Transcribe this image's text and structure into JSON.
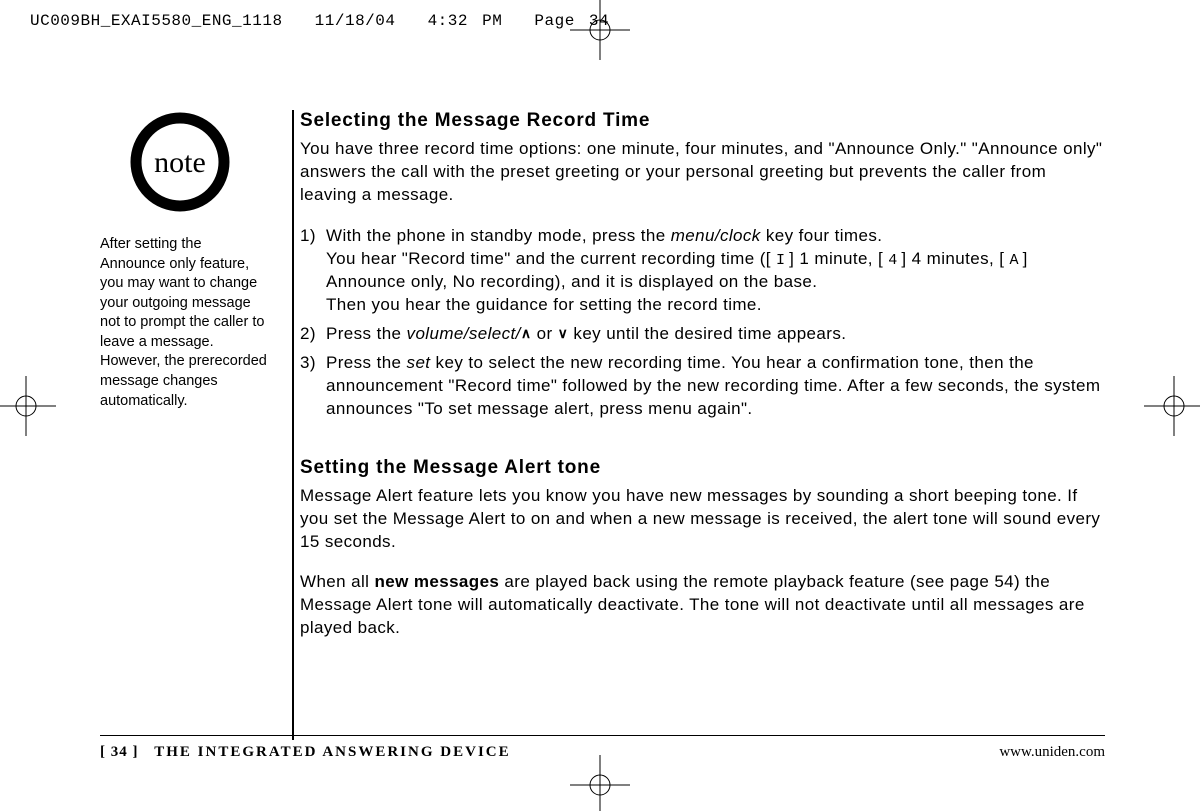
{
  "slug": {
    "file": "UC009BH_EXAI5580_ENG_1118",
    "date": "11/18/04",
    "time": "4:32 PM",
    "page": "Page 34"
  },
  "sidebar": {
    "icon_label": "note",
    "text": "After setting the Announce only feature, you may want to change your outgoing message not to prompt the caller to leave a message. However, the prerecorded message changes automatically."
  },
  "section1": {
    "heading": "Selecting the Message Record Time",
    "intro": "You have three record time options: one minute, four minutes, and \"Announce Only.\" \"Announce only\" answers the call with the preset greeting or your personal greeting but prevents the caller from leaving a message.",
    "step1_a": "With the phone in standby mode, press the ",
    "step1_key1": "menu/clock",
    "step1_b": " key four times.",
    "step1_c": "You hear \"Record time\" and the current recording time ([ ",
    "step1_seg1": "I",
    "step1_d": " ] 1 minute, [ ",
    "step1_seg2": "4",
    "step1_e": " ] 4 minutes, [ ",
    "step1_seg3": "A",
    "step1_f": " ] Announce only, No recording), and it is displayed on the base.",
    "step1_g": "Then you hear the guidance for setting the record time.",
    "step2_a": "Press the ",
    "step2_key": "volume/select/",
    "step2_b": " or ",
    "step2_c": " key until the desired time appears.",
    "step3_a": "Press the ",
    "step3_key": "set",
    "step3_b": " key to select the new recording time. You hear a confirmation tone, then the announcement \"Record time\" followed by the new recording time. After a few seconds, the system announces \"To set message alert, press menu again\"."
  },
  "section2": {
    "heading": "Setting the Message Alert tone",
    "p1": "Message Alert feature lets you know you have new messages by sounding a short beeping tone. If you set the Message Alert to on and when a new message is received, the alert tone will sound every 15 seconds.",
    "p2_a": "When all ",
    "p2_bold": "new messages",
    "p2_b": " are played back using the remote playback feature (see page 54) the Message Alert tone will automatically deactivate. The tone will not deactivate until all messages are played back."
  },
  "footer": {
    "page_number": "[ 34 ]",
    "section": "THE INTEGRATED ANSWERING DEVICE",
    "url": "www.uniden.com"
  }
}
